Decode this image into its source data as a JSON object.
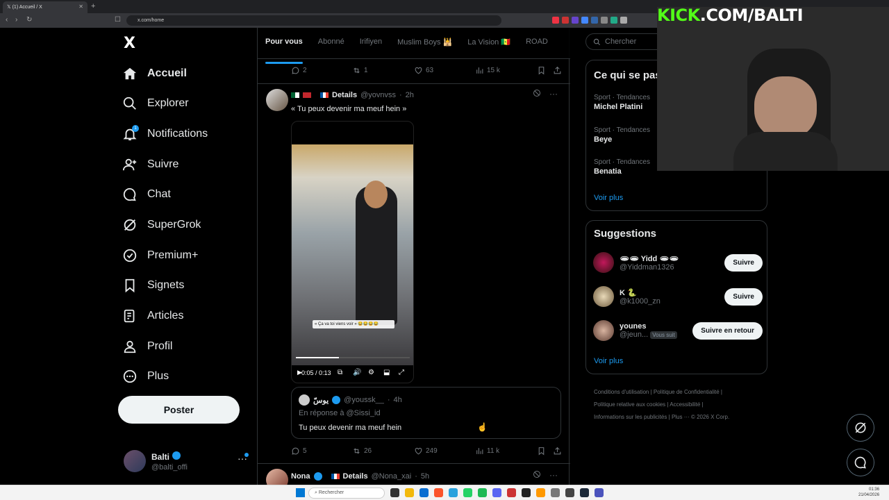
{
  "browser": {
    "tab_title": "(1) Accueil / X",
    "url": "x.com/home"
  },
  "sidebar": {
    "logo": "X",
    "notif_count": "1",
    "items": [
      {
        "label": "Accueil",
        "icon": "home-icon"
      },
      {
        "label": "Explorer",
        "icon": "search-icon"
      },
      {
        "label": "Notifications",
        "icon": "bell-icon"
      },
      {
        "label": "Suivre",
        "icon": "add-user-icon"
      },
      {
        "label": "Chat",
        "icon": "chat-icon"
      },
      {
        "label": "SuperGrok",
        "icon": "grok-icon"
      },
      {
        "label": "Premium+",
        "icon": "verified-badge-icon"
      },
      {
        "label": "Signets",
        "icon": "bookmark-icon"
      },
      {
        "label": "Articles",
        "icon": "article-icon"
      },
      {
        "label": "Profil",
        "icon": "profile-icon"
      },
      {
        "label": "Plus",
        "icon": "more-circle-icon"
      }
    ],
    "post_label": "Poster",
    "account": {
      "name": "Balti",
      "handle": "@balti_offi"
    }
  },
  "feed": {
    "tabs": [
      "Pour vous",
      "Abonné",
      "Irifiyen",
      "Muslim Boys 🕌",
      "La Vision 🇸🇳",
      "ROAD"
    ],
    "prev_actions": {
      "replies": "2",
      "reposts": "1",
      "likes": "63",
      "views": "15 k"
    },
    "tweet1": {
      "name": "Details",
      "handle": "@yovnvss",
      "time": "2h",
      "text": "« Tu peux devenir ma meuf hein »",
      "video_caption": "« Ça va toi viens voir » 😂😂😂😂",
      "video_time": "0:05 / 0:13",
      "video_progress": 0.38,
      "quote": {
        "name": "يوسّ",
        "handle": "@youssk__",
        "time": "4h",
        "reply_to": "En réponse à @Sissi_id",
        "text": "Tu peux devenir ma meuf hein"
      },
      "actions": {
        "replies": "5",
        "reposts": "26",
        "likes": "249",
        "views": "11 k"
      }
    },
    "tweet2": {
      "name": "Nona",
      "label": "Details",
      "handle": "@Nona_xai",
      "time": "5h"
    }
  },
  "right": {
    "search_placeholder": "Chercher",
    "trends_title": "Ce qui se pas",
    "trends": [
      {
        "category": "Sport · Tendances",
        "name": "Michel Platini"
      },
      {
        "category": "Sport · Tendances",
        "name": "Beye"
      },
      {
        "category": "Sport · Tendances",
        "name": "Benatia"
      }
    ],
    "trends_more": "Voir plus",
    "suggestions_title": "Suggestions",
    "suggestions": [
      {
        "name": "🕳🕳 Yidd 🕳🕳",
        "handle": "@Yiddman1326",
        "button": "Suivre",
        "follows_you": ""
      },
      {
        "name": "K 🐍",
        "handle": "@k1000_zn",
        "button": "Suivre",
        "follows_you": ""
      },
      {
        "name": "younes",
        "handle": "@jeun...",
        "button": "Suivre en retour",
        "follows_you": "Vous suit"
      }
    ],
    "suggestions_more": "Voir plus",
    "footer": [
      "Conditions d'utilisation",
      "Politique de Confidentialité",
      "Politique relative aux cookies",
      "Accessibilité",
      "Informations sur les publicités",
      "Plus ···",
      "© 2026 X Corp."
    ]
  },
  "overlay": {
    "kick_part1": "KICK",
    "kick_part2": ".COM/BALTI"
  },
  "taskbar": {
    "search": "Rechercher",
    "time": "01:36",
    "date": "21/04/2026"
  },
  "colors": {
    "accent": "#1d9bf0",
    "kick_green": "#53fc18",
    "background": "#000000"
  }
}
